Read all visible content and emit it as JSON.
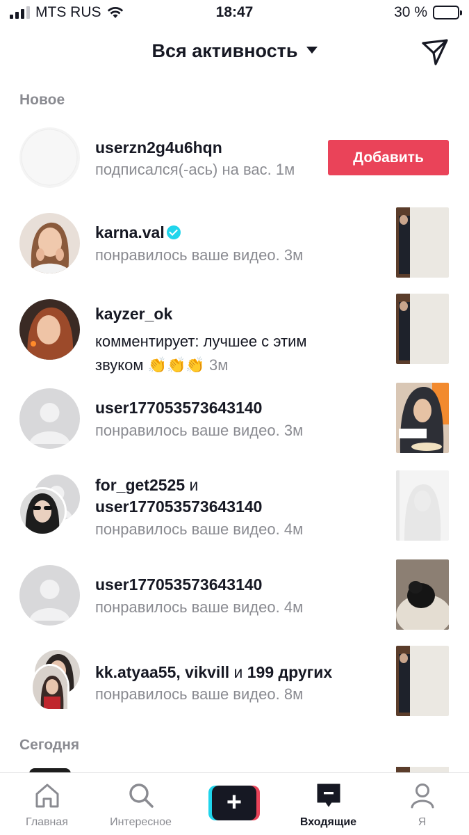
{
  "status_bar": {
    "carrier": "MTS RUS",
    "time": "18:47",
    "battery": "30 %",
    "battery_level": 0.3
  },
  "header": {
    "title": "Вся активность"
  },
  "sections": {
    "new": "Новое",
    "today": "Сегодня"
  },
  "activities": [
    {
      "user": "userzn2g4u6hqn",
      "action": "подписался(-ась) на вас.",
      "time": "1м",
      "button": "Добавить"
    },
    {
      "user": "karna.val",
      "verified": true,
      "action": "понравилось ваше видео.",
      "time": "3м"
    },
    {
      "user": "kayzer_ok",
      "action": "комментирует: лучшее с этим звуком 👏👏👏",
      "time": "3м"
    },
    {
      "user": "user1770535736431​40",
      "action": "понравилось ваше видео.",
      "time": "3м"
    },
    {
      "user": "for_get2525",
      "and": "и",
      "user2": "user177053573643140",
      "action": "понравилось ваше видео.",
      "time": "4м"
    },
    {
      "user": "user177053573643140",
      "action": "понравилось ваше видео.",
      "time": "4м"
    },
    {
      "users": "kk.atyaa55, vikvill",
      "and": "и",
      "others": "199 других",
      "action": "понравилось ваше видео.",
      "time": "8м"
    }
  ],
  "tabs": [
    {
      "label": "Главная",
      "icon": "home-icon"
    },
    {
      "label": "Интересное",
      "icon": "search-icon"
    },
    {
      "label": "",
      "icon": "plus-icon"
    },
    {
      "label": "Входящие",
      "icon": "inbox-icon",
      "active": true
    },
    {
      "label": "Я",
      "icon": "profile-icon"
    }
  ],
  "colors": {
    "accent": "#ea4359",
    "cyan": "#20d5ec",
    "text": "#161823",
    "muted": "#8a8b91"
  }
}
